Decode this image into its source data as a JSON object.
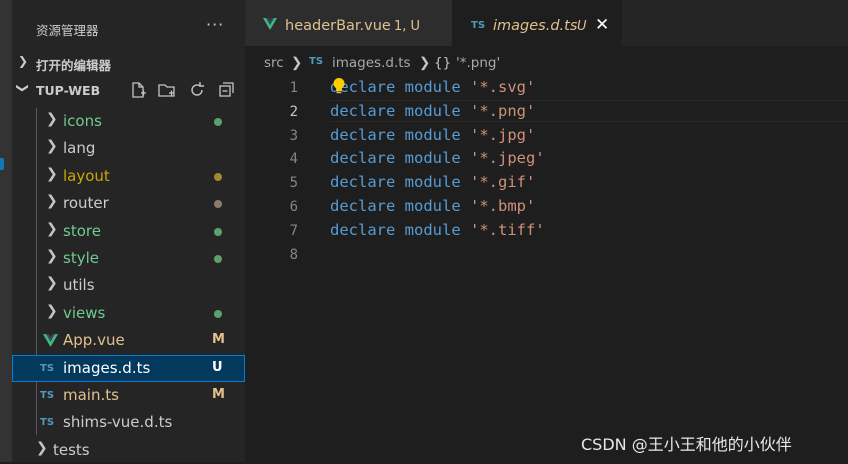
{
  "explorer": {
    "title": "资源管理器",
    "more": "···",
    "open_editors": "打开的编辑器",
    "project": "TUP-WEB",
    "toolbar_icons": [
      "new-file-icon",
      "new-folder-icon",
      "refresh-icon",
      "collapse-all-icon"
    ]
  },
  "tree": [
    {
      "label": "icons",
      "type": "folder",
      "color": "#73c991",
      "decoration": "dot",
      "decoration_color": "#5f9f6f"
    },
    {
      "label": "lang",
      "type": "folder",
      "color": "#cccccc",
      "decoration": "",
      "decoration_color": ""
    },
    {
      "label": "layout",
      "type": "folder",
      "color": "#cca700",
      "decoration": "dot",
      "decoration_color": "#a08a2f"
    },
    {
      "label": "router",
      "type": "folder",
      "color": "#cccccc",
      "decoration": "dot",
      "decoration_color": "#8c7b6b"
    },
    {
      "label": "store",
      "type": "folder",
      "color": "#73c991",
      "decoration": "dot",
      "decoration_color": "#5f9f6f"
    },
    {
      "label": "style",
      "type": "folder",
      "color": "#73c991",
      "decoration": "dot",
      "decoration_color": "#5f9f6f"
    },
    {
      "label": "utils",
      "type": "folder",
      "color": "#cccccc",
      "decoration": "",
      "decoration_color": ""
    },
    {
      "label": "views",
      "type": "folder",
      "color": "#73c991",
      "decoration": "dot",
      "decoration_color": "#5f9f6f"
    },
    {
      "label": "App.vue",
      "type": "vue",
      "color": "#e2c08d",
      "decoration": "M",
      "decoration_color": "#e2c08d"
    },
    {
      "label": "images.d.ts",
      "type": "ts",
      "color": "#ffffff",
      "decoration": "U",
      "decoration_color": "#ffffff",
      "selected": true
    },
    {
      "label": "main.ts",
      "type": "ts",
      "color": "#e2c08d",
      "decoration": "M",
      "decoration_color": "#e2c08d"
    },
    {
      "label": "shims-vue.d.ts",
      "type": "ts",
      "color": "#cccccc",
      "decoration": "",
      "decoration_color": ""
    },
    {
      "label": "tests",
      "type": "root-folder",
      "color": "#cccccc",
      "decoration": "",
      "decoration_color": ""
    }
  ],
  "tabs": [
    {
      "name": "headerBar.vue",
      "badge": "1, U",
      "active": false
    },
    {
      "name": "images.d.ts",
      "badge": "U",
      "active": true
    }
  ],
  "ts_label": "TS",
  "close_glyph": "✕",
  "breadcrumb": {
    "src": "src",
    "file": "images.d.ts",
    "braces": "{}",
    "symbol": "'*.png'"
  },
  "editor": {
    "line_numbers": [
      "1",
      "2",
      "3",
      "4",
      "5",
      "6",
      "7",
      "8"
    ],
    "active_line": 2,
    "lines": [
      {
        "keyword": "declare module",
        "string": "'*.svg'"
      },
      {
        "keyword": "declare module",
        "string": "'*.png'"
      },
      {
        "keyword": "declare module",
        "string": "'*.jpg'"
      },
      {
        "keyword": "declare module",
        "string": "'*.jpeg'"
      },
      {
        "keyword": "declare module",
        "string": "'*.gif'"
      },
      {
        "keyword": "declare module",
        "string": "'*.bmp'"
      },
      {
        "keyword": "declare module",
        "string": "'*.tiff'"
      },
      {
        "keyword": "",
        "string": ""
      }
    ]
  },
  "watermark": "CSDN @王小王和他的小伙伴"
}
